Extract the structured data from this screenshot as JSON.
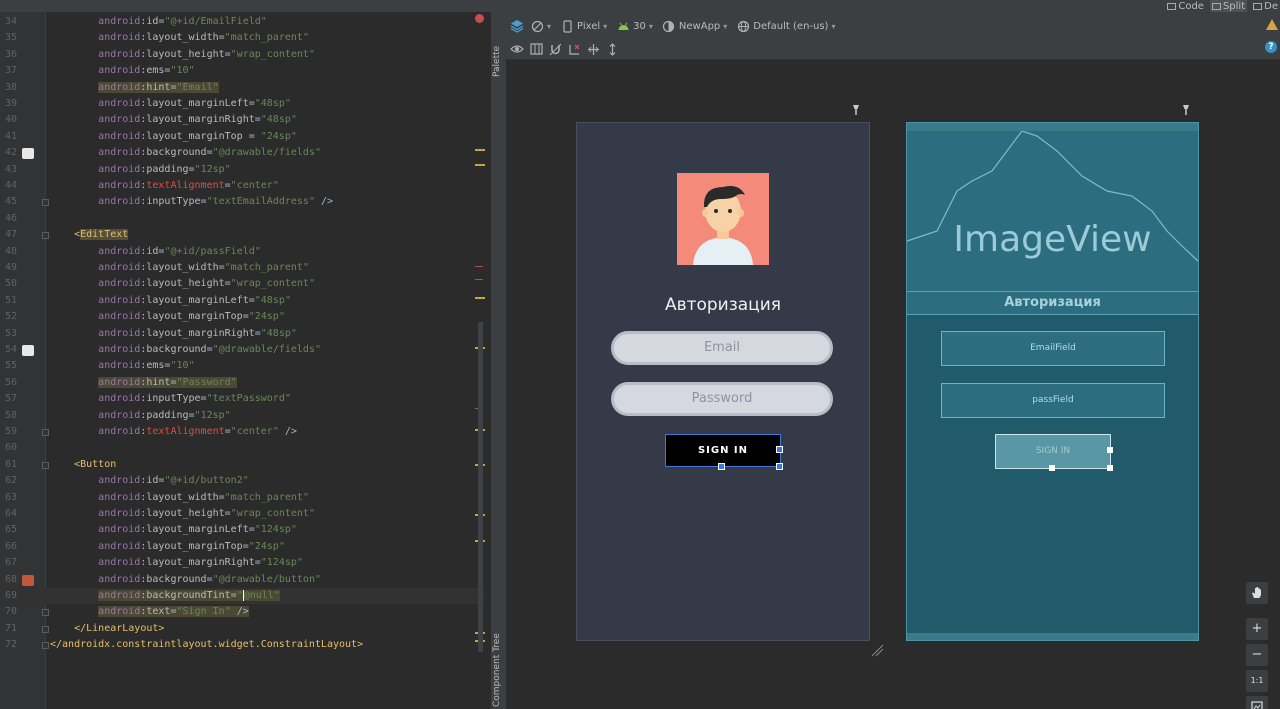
{
  "view_modes": [
    {
      "label": "Code",
      "active": false
    },
    {
      "label": "Split",
      "active": true
    },
    {
      "label": "De",
      "active": false
    }
  ],
  "editor": {
    "lines": [
      {
        "n": "34",
        "indent": "        ",
        "parts": [
          [
            "ns",
            "android"
          ],
          [
            "p",
            ":"
          ],
          [
            "attr",
            "id"
          ],
          [
            "p",
            "="
          ],
          [
            "val",
            "\"@+id/EmailField\""
          ]
        ]
      },
      {
        "n": "35",
        "indent": "        ",
        "parts": [
          [
            "ns",
            "android"
          ],
          [
            "p",
            ":"
          ],
          [
            "attr",
            "layout_width"
          ],
          [
            "p",
            "="
          ],
          [
            "val",
            "\"match_parent\""
          ]
        ]
      },
      {
        "n": "36",
        "indent": "        ",
        "parts": [
          [
            "ns",
            "android"
          ],
          [
            "p",
            ":"
          ],
          [
            "attr",
            "layout_height"
          ],
          [
            "p",
            "="
          ],
          [
            "val",
            "\"wrap_content\""
          ]
        ]
      },
      {
        "n": "37",
        "indent": "        ",
        "parts": [
          [
            "ns",
            "android"
          ],
          [
            "p",
            ":"
          ],
          [
            "attr",
            "ems"
          ],
          [
            "p",
            "="
          ],
          [
            "val",
            "\"10\""
          ]
        ]
      },
      {
        "n": "38",
        "indent": "        ",
        "hl": true,
        "parts": [
          [
            "ns",
            "android"
          ],
          [
            "p",
            ":"
          ],
          [
            "attr",
            "hint"
          ],
          [
            "p",
            "="
          ],
          [
            "val",
            "\"Email\""
          ]
        ]
      },
      {
        "n": "39",
        "indent": "        ",
        "parts": [
          [
            "ns",
            "android"
          ],
          [
            "p",
            ":"
          ],
          [
            "attr",
            "layout_marginLeft"
          ],
          [
            "p",
            "="
          ],
          [
            "val",
            "\"48sp\""
          ]
        ]
      },
      {
        "n": "40",
        "indent": "        ",
        "parts": [
          [
            "ns",
            "android"
          ],
          [
            "p",
            ":"
          ],
          [
            "attr",
            "layout_marginRight"
          ],
          [
            "p",
            "="
          ],
          [
            "val",
            "\"48sp\""
          ]
        ]
      },
      {
        "n": "41",
        "indent": "        ",
        "parts": [
          [
            "ns",
            "android"
          ],
          [
            "p",
            ":"
          ],
          [
            "attr",
            "layout_marginTop"
          ],
          [
            "p",
            " = "
          ],
          [
            "val",
            "\"24sp\""
          ]
        ]
      },
      {
        "n": "42",
        "indent": "        ",
        "marker": "#e8e8e8",
        "parts": [
          [
            "ns",
            "android"
          ],
          [
            "p",
            ":"
          ],
          [
            "attr",
            "background"
          ],
          [
            "p",
            "="
          ],
          [
            "val",
            "\"@drawable/fields\""
          ]
        ]
      },
      {
        "n": "43",
        "indent": "        ",
        "parts": [
          [
            "ns",
            "android"
          ],
          [
            "p",
            ":"
          ],
          [
            "attr",
            "padding"
          ],
          [
            "p",
            "="
          ],
          [
            "val",
            "\"12sp\""
          ]
        ]
      },
      {
        "n": "44",
        "indent": "        ",
        "parts": [
          [
            "ns",
            "android"
          ],
          [
            "p",
            ":"
          ],
          [
            "bad",
            "textAlignment"
          ],
          [
            "p",
            "="
          ],
          [
            "val",
            "\"center\""
          ]
        ]
      },
      {
        "n": "45",
        "indent": "        ",
        "fold": true,
        "parts": [
          [
            "ns",
            "android"
          ],
          [
            "p",
            ":"
          ],
          [
            "attr",
            "inputType"
          ],
          [
            "p",
            "="
          ],
          [
            "val",
            "\"textEmailAddress\""
          ],
          [
            "p",
            " />"
          ]
        ]
      },
      {
        "n": "46",
        "indent": "",
        "parts": []
      },
      {
        "n": "47",
        "indent": "    ",
        "fold": true,
        "parts": [
          [
            "tag",
            "<"
          ],
          [
            "taghl",
            "EditText"
          ]
        ]
      },
      {
        "n": "48",
        "indent": "        ",
        "parts": [
          [
            "ns",
            "android"
          ],
          [
            "p",
            ":"
          ],
          [
            "attr",
            "id"
          ],
          [
            "p",
            "="
          ],
          [
            "val",
            "\"@+id/passField\""
          ]
        ]
      },
      {
        "n": "49",
        "indent": "        ",
        "parts": [
          [
            "ns",
            "android"
          ],
          [
            "p",
            ":"
          ],
          [
            "attr",
            "layout_width"
          ],
          [
            "p",
            "="
          ],
          [
            "val",
            "\"match_parent\""
          ]
        ]
      },
      {
        "n": "50",
        "indent": "        ",
        "parts": [
          [
            "ns",
            "android"
          ],
          [
            "p",
            ":"
          ],
          [
            "attr",
            "layout_height"
          ],
          [
            "p",
            "="
          ],
          [
            "val",
            "\"wrap_content\""
          ]
        ]
      },
      {
        "n": "51",
        "indent": "        ",
        "parts": [
          [
            "ns",
            "android"
          ],
          [
            "p",
            ":"
          ],
          [
            "attr",
            "layout_marginLeft"
          ],
          [
            "p",
            "="
          ],
          [
            "val",
            "\"48sp\""
          ]
        ]
      },
      {
        "n": "52",
        "indent": "        ",
        "parts": [
          [
            "ns",
            "android"
          ],
          [
            "p",
            ":"
          ],
          [
            "attr",
            "layout_marginTop"
          ],
          [
            "p",
            "="
          ],
          [
            "val",
            "\"24sp\""
          ]
        ]
      },
      {
        "n": "53",
        "indent": "        ",
        "parts": [
          [
            "ns",
            "android"
          ],
          [
            "p",
            ":"
          ],
          [
            "attr",
            "layout_marginRight"
          ],
          [
            "p",
            "="
          ],
          [
            "val",
            "\"48sp\""
          ]
        ]
      },
      {
        "n": "54",
        "indent": "        ",
        "marker": "#e8e8e8",
        "parts": [
          [
            "ns",
            "android"
          ],
          [
            "p",
            ":"
          ],
          [
            "attr",
            "background"
          ],
          [
            "p",
            "="
          ],
          [
            "val",
            "\"@drawable/fields\""
          ]
        ]
      },
      {
        "n": "55",
        "indent": "        ",
        "parts": [
          [
            "ns",
            "android"
          ],
          [
            "p",
            ":"
          ],
          [
            "attr",
            "ems"
          ],
          [
            "p",
            "="
          ],
          [
            "val",
            "\"10\""
          ]
        ]
      },
      {
        "n": "56",
        "indent": "        ",
        "hl": true,
        "parts": [
          [
            "ns",
            "android"
          ],
          [
            "p",
            ":"
          ],
          [
            "attr",
            "hint"
          ],
          [
            "p",
            "="
          ],
          [
            "val",
            "\"Password\""
          ]
        ]
      },
      {
        "n": "57",
        "indent": "        ",
        "parts": [
          [
            "ns",
            "android"
          ],
          [
            "p",
            ":"
          ],
          [
            "attr",
            "inputType"
          ],
          [
            "p",
            "="
          ],
          [
            "val",
            "\"textPassword\""
          ]
        ]
      },
      {
        "n": "58",
        "indent": "        ",
        "parts": [
          [
            "ns",
            "android"
          ],
          [
            "p",
            ":"
          ],
          [
            "attr",
            "padding"
          ],
          [
            "p",
            "="
          ],
          [
            "val",
            "\"12sp\""
          ]
        ]
      },
      {
        "n": "59",
        "indent": "        ",
        "fold": true,
        "parts": [
          [
            "ns",
            "android"
          ],
          [
            "p",
            ":"
          ],
          [
            "bad",
            "textAlignment"
          ],
          [
            "p",
            "="
          ],
          [
            "val",
            "\"center\""
          ],
          [
            "p",
            " />"
          ]
        ]
      },
      {
        "n": "60",
        "indent": "",
        "parts": []
      },
      {
        "n": "61",
        "indent": "    ",
        "fold": true,
        "parts": [
          [
            "tag",
            "<Button"
          ]
        ]
      },
      {
        "n": "62",
        "indent": "        ",
        "parts": [
          [
            "ns",
            "android"
          ],
          [
            "p",
            ":"
          ],
          [
            "attr",
            "id"
          ],
          [
            "p",
            "="
          ],
          [
            "val",
            "\"@+id/button2\""
          ]
        ]
      },
      {
        "n": "63",
        "indent": "        ",
        "parts": [
          [
            "ns",
            "android"
          ],
          [
            "p",
            ":"
          ],
          [
            "attr",
            "layout_width"
          ],
          [
            "p",
            "="
          ],
          [
            "val",
            "\"match_parent\""
          ]
        ]
      },
      {
        "n": "64",
        "indent": "        ",
        "parts": [
          [
            "ns",
            "android"
          ],
          [
            "p",
            ":"
          ],
          [
            "attr",
            "layout_height"
          ],
          [
            "p",
            "="
          ],
          [
            "val",
            "\"wrap_content\""
          ]
        ]
      },
      {
        "n": "65",
        "indent": "        ",
        "parts": [
          [
            "ns",
            "android"
          ],
          [
            "p",
            ":"
          ],
          [
            "attr",
            "layout_marginLeft"
          ],
          [
            "p",
            "="
          ],
          [
            "val",
            "\"124sp\""
          ]
        ]
      },
      {
        "n": "66",
        "indent": "        ",
        "parts": [
          [
            "ns",
            "android"
          ],
          [
            "p",
            ":"
          ],
          [
            "attr",
            "layout_marginTop"
          ],
          [
            "p",
            "="
          ],
          [
            "val",
            "\"24sp\""
          ]
        ]
      },
      {
        "n": "67",
        "indent": "        ",
        "parts": [
          [
            "ns",
            "android"
          ],
          [
            "p",
            ":"
          ],
          [
            "attr",
            "layout_marginRight"
          ],
          [
            "p",
            "="
          ],
          [
            "val",
            "\"124sp\""
          ]
        ]
      },
      {
        "n": "68",
        "indent": "        ",
        "marker": "#c4573a",
        "parts": [
          [
            "ns",
            "android"
          ],
          [
            "p",
            ":"
          ],
          [
            "attr",
            "background"
          ],
          [
            "p",
            "="
          ],
          [
            "val",
            "\"@drawable/button\""
          ]
        ]
      },
      {
        "n": "69",
        "indent": "        ",
        "hl": true,
        "current": true,
        "parts": [
          [
            "ns",
            "android"
          ],
          [
            "p",
            ":"
          ],
          [
            "attr",
            "backgroundTint"
          ],
          [
            "p",
            "="
          ],
          [
            "val",
            "\""
          ],
          [
            "caret",
            "@"
          ],
          [
            "val",
            "null\""
          ]
        ]
      },
      {
        "n": "70",
        "indent": "        ",
        "fold": true,
        "hl": true,
        "parts": [
          [
            "ns",
            "android"
          ],
          [
            "p",
            ":"
          ],
          [
            "attr",
            "text"
          ],
          [
            "p",
            "="
          ],
          [
            "val",
            "\"Sign In\""
          ],
          [
            "p",
            " />"
          ]
        ]
      },
      {
        "n": "71",
        "indent": "    ",
        "fold": true,
        "parts": [
          [
            "tag",
            "</LinearLayout>"
          ]
        ]
      },
      {
        "n": "72",
        "indent": "",
        "fold": true,
        "parts": [
          [
            "tag",
            "</androidx.constraintlayout.widget.ConstraintLayout>"
          ]
        ]
      }
    ]
  },
  "side_panels": {
    "palette": "Palette",
    "component_tree": "Component Tree"
  },
  "toolbar": {
    "device": "Pixel",
    "api_level": "30",
    "theme": "NewApp",
    "locale": "Default (en-us)"
  },
  "phone_preview": {
    "title": "Авторизация",
    "email_hint": "Email",
    "password_hint": "Password",
    "button_label": "SIGN IN"
  },
  "blueprint": {
    "image_label": "ImageView",
    "title": "Авторизация",
    "email_id": "EmailField",
    "pass_id": "passField",
    "button_label": "SIGN IN"
  },
  "zoom": {
    "zoom_in": "+",
    "zoom_out": "−",
    "actual_size": "1:1"
  }
}
